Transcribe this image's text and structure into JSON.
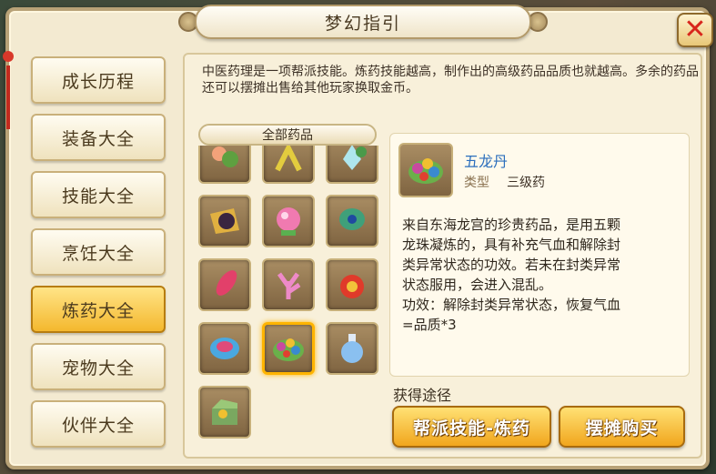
{
  "window": {
    "title": "梦幻指引"
  },
  "menu": {
    "items": [
      {
        "label": "成长历程",
        "active": false
      },
      {
        "label": "装备大全",
        "active": false
      },
      {
        "label": "技能大全",
        "active": false
      },
      {
        "label": "烹饪大全",
        "active": false
      },
      {
        "label": "炼药大全",
        "active": true
      },
      {
        "label": "宠物大全",
        "active": false
      },
      {
        "label": "伙伴大全",
        "active": false
      }
    ]
  },
  "intro": "中医药理是一项帮派技能。炼药技能越高，制作出的高级药品品质也就越高。多余的药品还可以摆摊出售给其他玩家换取金币。",
  "list": {
    "tab_label": "全部药品",
    "items": [
      {
        "icon": "flower-herb-icon",
        "color": "#e88a5a"
      },
      {
        "icon": "antler-herb-icon",
        "color": "#d9c23a"
      },
      {
        "icon": "crystal-herb-icon",
        "color": "#7ad0d8"
      },
      {
        "icon": "leaf-ball-icon",
        "color": "#3a2a40"
      },
      {
        "icon": "pink-orb-icon",
        "color": "#e85a9a"
      },
      {
        "icon": "peacock-feather-icon",
        "color": "#3a8a6a"
      },
      {
        "icon": "red-feather-icon",
        "color": "#d8405a"
      },
      {
        "icon": "coral-icon",
        "color": "#e07ac0"
      },
      {
        "icon": "red-pouch-icon",
        "color": "#d83a2a"
      },
      {
        "icon": "blue-bowl-icon",
        "color": "#4aa0d8"
      },
      {
        "icon": "five-dragon-pill-icon",
        "color": "#6aa84a",
        "selected": true
      },
      {
        "icon": "potion-bottle-icon",
        "color": "#7ab0e8"
      },
      {
        "icon": "jade-box-icon",
        "color": "#6a9a5a"
      }
    ]
  },
  "detail": {
    "name": "五龙丹",
    "type_label": "类型",
    "type_value": "三级药",
    "description_lines": [
      "来自东海龙宫的珍贵药品，是用五颗",
      "龙珠凝炼的，具有补充气血和解除封",
      "类异常状态的功效。若未在封类异常",
      "状态服用，会进入混乱。",
      "功效：解除封类异常状态，恢复气血",
      "=品质*3"
    ],
    "icon": "five-dragon-pill-icon"
  },
  "obtain": {
    "label": "获得途径",
    "buttons": [
      {
        "label": "帮派技能-炼药"
      },
      {
        "label": "摆摊购买"
      }
    ]
  },
  "colors": {
    "accent": "#f4b82e",
    "name_blue": "#2c6fbd",
    "close_red": "#d8261c"
  }
}
